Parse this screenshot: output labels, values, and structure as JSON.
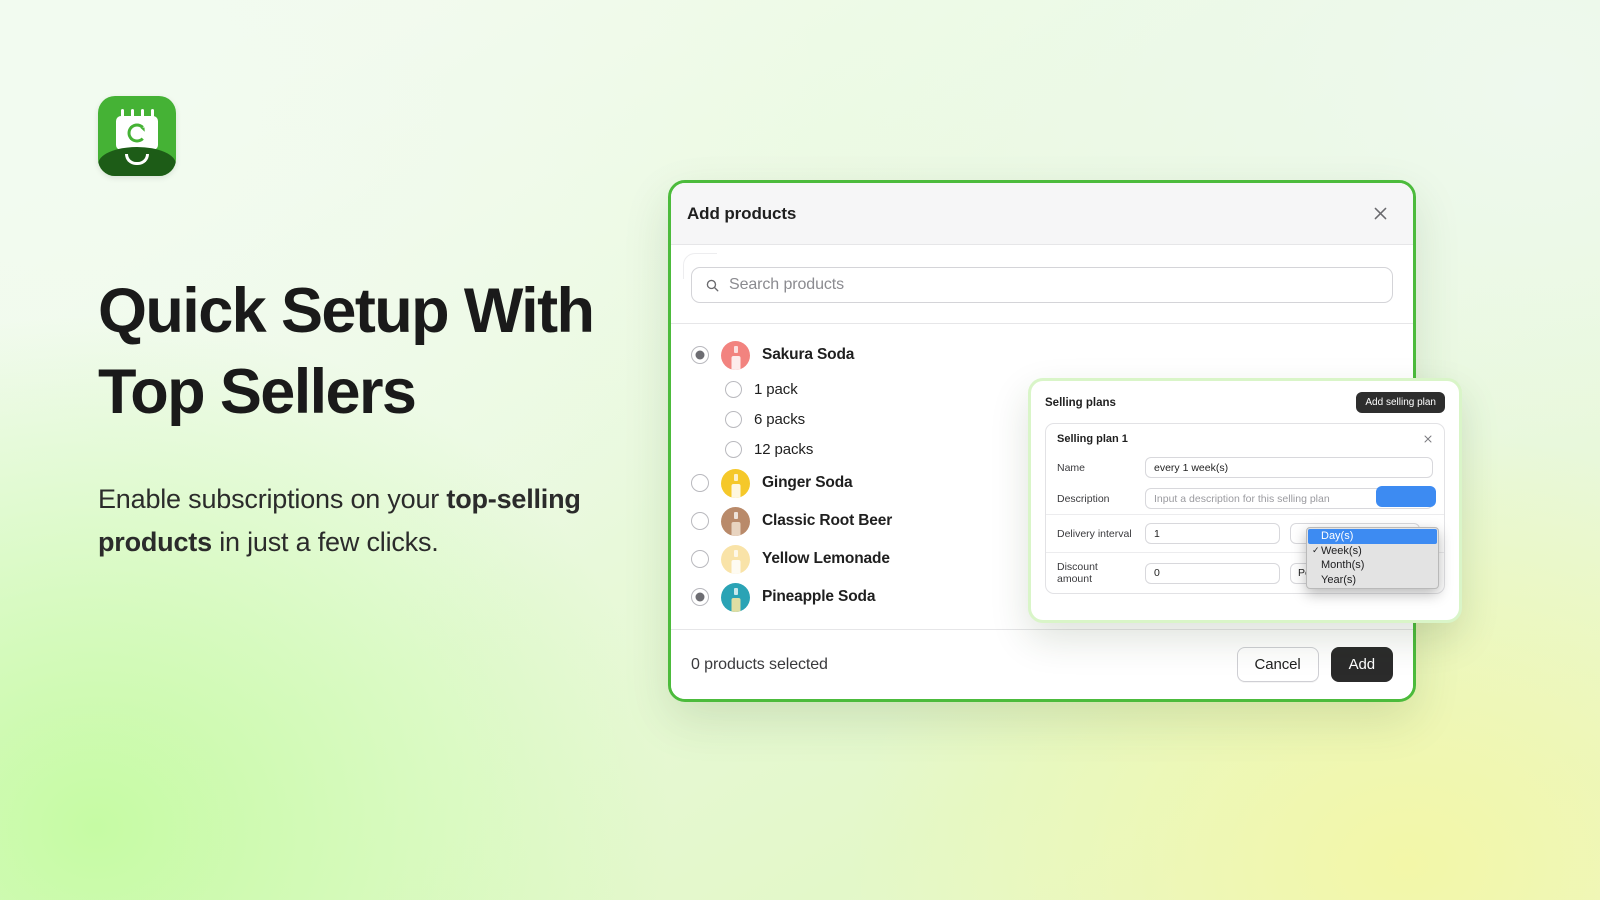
{
  "brand": {
    "app_icon_name": "calendar-refresh-icon",
    "icon_bg": "#45b235",
    "icon_bag": "#1d5c17"
  },
  "hero": {
    "headline": "Quick Setup With Top Sellers",
    "sub_part1": "Enable subscriptions on your ",
    "sub_bold": "top-selling products",
    "sub_part2": " in just a few clicks."
  },
  "modal": {
    "title": "Add products",
    "close_icon": "close-icon",
    "search": {
      "icon": "search-icon",
      "placeholder": "Search products"
    },
    "products": [
      {
        "name": "Sakura Soda",
        "selected": true,
        "thumb": "#f2837f",
        "bottle": "#ffffff",
        "variants": [
          {
            "name": "1 pack",
            "selected": false
          },
          {
            "name": "6 packs",
            "selected": false
          },
          {
            "name": "12 packs",
            "selected": false
          }
        ]
      },
      {
        "name": "Ginger Soda",
        "selected": false,
        "thumb": "#f5c82a",
        "bottle": "#ffffff",
        "variants": []
      },
      {
        "name": "Classic Root Beer",
        "selected": false,
        "thumb": "#b98a6a",
        "bottle": "#f0e0cf",
        "variants": []
      },
      {
        "name": "Yellow Lemonade",
        "selected": false,
        "thumb": "#f9e3a8",
        "bottle": "#ffffff",
        "variants": []
      },
      {
        "name": "Pineapple Soda",
        "selected": true,
        "thumb": "#2aa3b5",
        "bottle": "#ffe9a0",
        "variants": []
      }
    ],
    "footer": {
      "count_label": "0 products selected",
      "cancel_label": "Cancel",
      "add_label": "Add"
    }
  },
  "selling_plans": {
    "panel_title": "Selling plans",
    "add_button": "Add selling plan",
    "card_title": "Selling plan 1",
    "close_icon": "close-icon",
    "fields": {
      "name_label": "Name",
      "name_value": "every 1 week(s)",
      "description_label": "Description",
      "description_placeholder": "Input a description for this selling plan",
      "delivery_label": "Delivery interval",
      "delivery_value": "1",
      "discount_label": "Discount amount",
      "discount_value": "0",
      "discount_type": "Percentage off (%)"
    },
    "dropdown": {
      "options": [
        {
          "label": "Day(s)",
          "highlighted": true,
          "checked": false
        },
        {
          "label": "Week(s)",
          "highlighted": false,
          "checked": true
        },
        {
          "label": "Month(s)",
          "highlighted": false,
          "checked": false
        },
        {
          "label": "Year(s)",
          "highlighted": false,
          "checked": false
        }
      ],
      "highlight_color": "#3d8bf2"
    }
  }
}
